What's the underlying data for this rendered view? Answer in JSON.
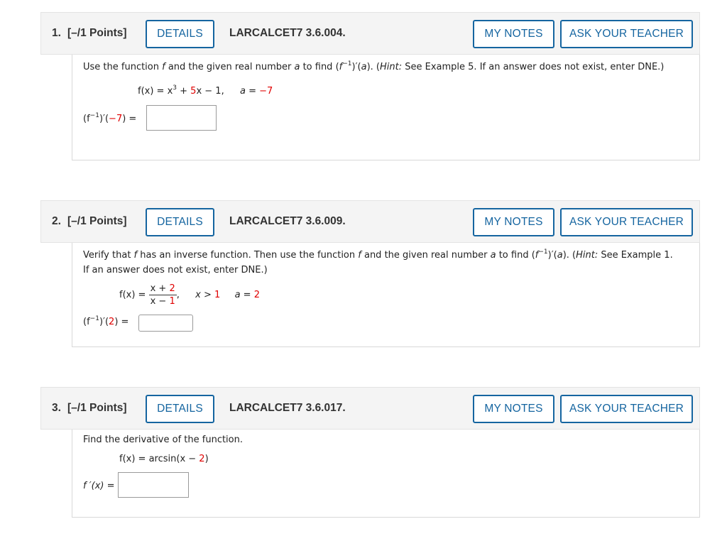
{
  "questions": [
    {
      "number": "1.",
      "points": "[–/1 Points]",
      "details_label": "DETAILS",
      "code": "LARCALCET7 3.6.004.",
      "notes_label": "MY NOTES",
      "ask_label": "ASK YOUR TEACHER",
      "prompt_a": "Use the function ",
      "prompt_f": "f",
      "prompt_b": " and the given real number ",
      "prompt_a_var": "a",
      "prompt_c": " to find (",
      "prompt_f2": "f",
      "prompt_sup": "−1",
      "prompt_d": ")′(",
      "prompt_a2": "a",
      "prompt_e": "). (",
      "hint_label": "Hint:",
      "hint_text": " See Example 5. If an answer does not exist, enter DNE.)",
      "func_lhs": "f(x) = x",
      "func_exp": "3",
      "func_plus": " + ",
      "func_coef": "5",
      "func_rest": "x − 1,",
      "a_label": "a = ",
      "a_value": "−7",
      "answer_lhs": "(f",
      "answer_sup": "−1",
      "answer_mid": ")′(",
      "answer_arg": "−7",
      "answer_end": ") ="
    },
    {
      "number": "2.",
      "points": "[–/1 Points]",
      "details_label": "DETAILS",
      "code": "LARCALCET7 3.6.009.",
      "notes_label": "MY NOTES",
      "ask_label": "ASK YOUR TEACHER",
      "line1_a": "Verify that ",
      "line1_f": "f",
      "line1_b": " has an inverse function. Then use the function ",
      "line1_f2": "f",
      "line1_c": " and the given real number ",
      "line1_a_var": "a",
      "line1_d": " to find (",
      "line1_f3": "f",
      "line1_sup": "−1",
      "line1_e": ")′(",
      "line1_a2": "a",
      "line1_g": "). (",
      "hint_label": "Hint:",
      "hint_text": " See Example 1.",
      "line2": "If an answer does not exist, enter DNE.)",
      "func_lhs": "f(x) = ",
      "frac_num_x": "x + ",
      "frac_num_c": "2",
      "frac_den_x": "x − ",
      "frac_den_c": "1",
      "comma": ",",
      "cond_x": "x > ",
      "cond_val": "1",
      "a_label": "a = ",
      "a_value": "2",
      "answer_lhs": "(f",
      "answer_sup": "−1",
      "answer_mid": ")′(",
      "answer_arg": "2",
      "answer_end": ") ="
    },
    {
      "number": "3.",
      "points": "[–/1 Points]",
      "details_label": "DETAILS",
      "code": "LARCALCET7 3.6.017.",
      "notes_label": "MY NOTES",
      "ask_label": "ASK YOUR TEACHER",
      "prompt": "Find the derivative of the function.",
      "func_lhs": "f(x) = arcsin(x − ",
      "func_c": "2",
      "func_end": ")",
      "answer_lhs": "f ′(x) ="
    }
  ]
}
